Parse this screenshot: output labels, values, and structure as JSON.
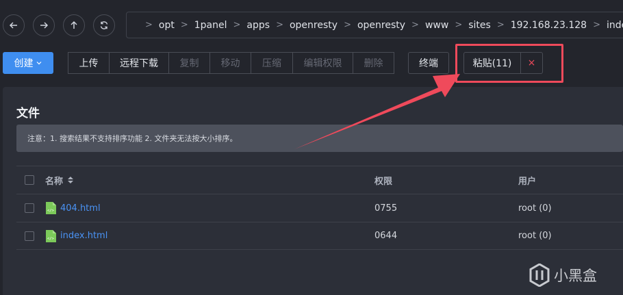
{
  "nav": {
    "back_icon": "arrow-left-icon",
    "forward_icon": "arrow-right-icon",
    "up_icon": "arrow-up-icon",
    "refresh_icon": "refresh-icon"
  },
  "breadcrumb": {
    "home_icon": "home-icon",
    "items": [
      "opt",
      "1panel",
      "apps",
      "openresty",
      "openresty",
      "www",
      "sites",
      "192.168.23.128",
      "index"
    ],
    "separator": ">"
  },
  "toolbar": {
    "create_label": "创建",
    "upload_label": "上传",
    "remote_download_label": "远程下载",
    "copy_label": "复制",
    "move_label": "移动",
    "compress_label": "压缩",
    "edit_permission_label": "编辑权限",
    "delete_label": "删除",
    "terminal_label": "终端",
    "paste_label": "粘贴(11)",
    "cancel_paste_label": "×"
  },
  "panel": {
    "title": "文件",
    "notice": "注意：1. 搜索结果不支持排序功能 2. 文件夹无法按大小排序。"
  },
  "table": {
    "headers": {
      "name": "名称",
      "permission": "权限",
      "user": "用户"
    },
    "rows": [
      {
        "name": "404.html",
        "permission": "0755",
        "user": "root (0)"
      },
      {
        "name": "index.html",
        "permission": "0644",
        "user": "root (0)"
      }
    ]
  },
  "watermark": {
    "text": "小黑盒"
  },
  "colors": {
    "accent": "#3f8ef0",
    "link": "#4a93f5",
    "annotation": "#ef4a5b",
    "background": "#23252c"
  }
}
